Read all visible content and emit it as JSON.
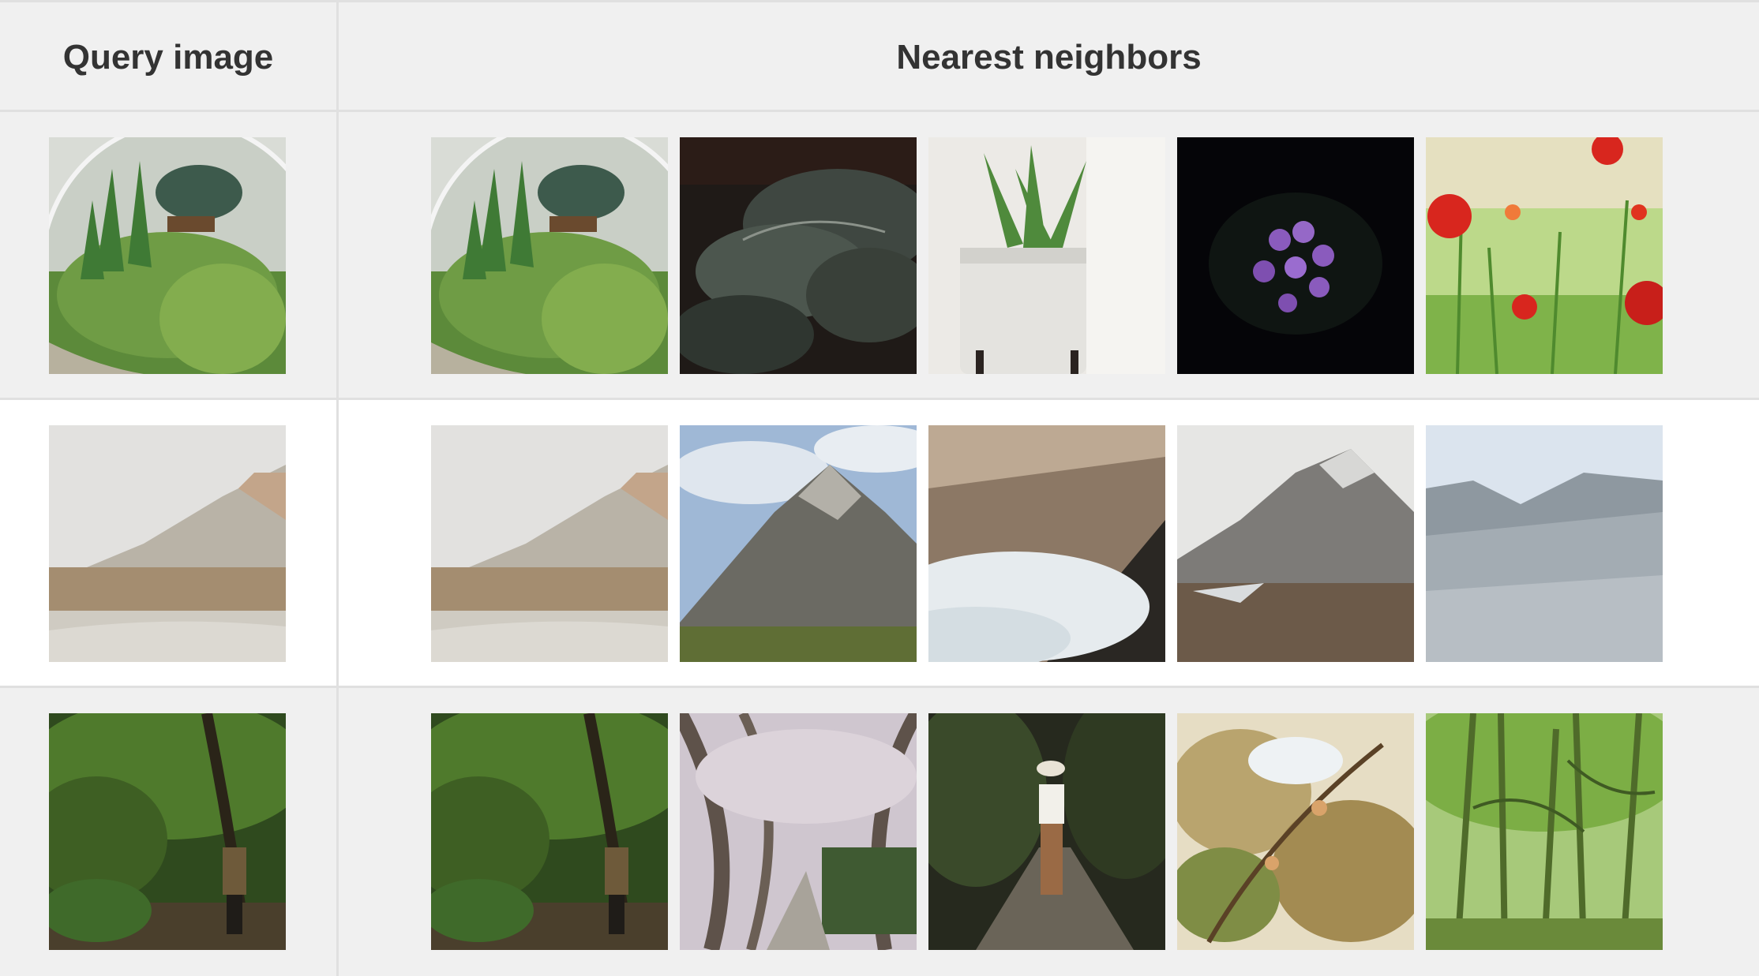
{
  "header": {
    "query_label": "Query image",
    "neighbors_label": "Nearest neighbors"
  },
  "colors": {
    "table_bg_alt": "#f0f0f0",
    "table_border": "#e0e0e0",
    "header_text": "#333333"
  },
  "rows": [
    {
      "query": {
        "icon": "terrarium-succulent-photo"
      },
      "neighbors": [
        {
          "icon": "terrarium-succulent-photo"
        },
        {
          "icon": "dark-foliage-photo"
        },
        {
          "icon": "potted-snake-plant-photo"
        },
        {
          "icon": "purple-violet-flowers-photo"
        },
        {
          "icon": "red-poppies-field-photo"
        }
      ]
    },
    {
      "query": {
        "icon": "snowy-cliff-fog-photo"
      },
      "neighbors": [
        {
          "icon": "snowy-cliff-fog-photo"
        },
        {
          "icon": "mountain-peak-blue-sky-photo"
        },
        {
          "icon": "misty-forested-valley-photo"
        },
        {
          "icon": "snowy-rocky-peaks-photo"
        },
        {
          "icon": "snow-covered-forest-slope-photo"
        }
      ]
    },
    {
      "query": {
        "icon": "person-in-forest-photo"
      },
      "neighbors": [
        {
          "icon": "person-in-forest-photo"
        },
        {
          "icon": "tree-tunnel-path-photo"
        },
        {
          "icon": "woman-walking-forest-path-photo"
        },
        {
          "icon": "blossoming-branches-photo"
        },
        {
          "icon": "bamboo-forest-photo"
        }
      ]
    }
  ]
}
